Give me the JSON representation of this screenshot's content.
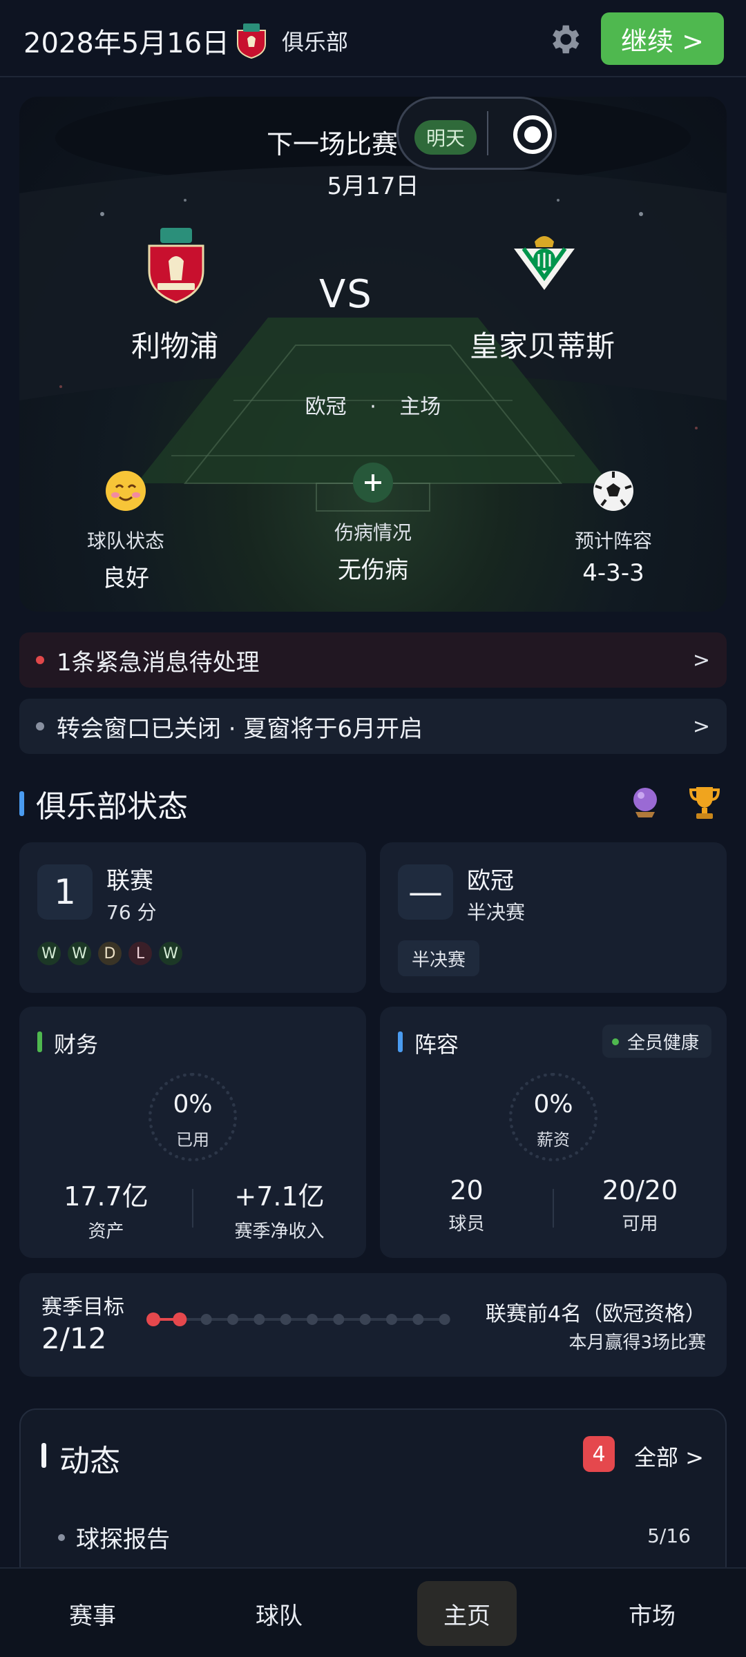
{
  "topbar": {
    "date": "2028年5月16日",
    "club_name": "俱乐部",
    "continue_label": "继续 >",
    "settings_icon": "gear-icon",
    "accent_color": "#4fb84f"
  },
  "next_match": {
    "label": "下一场比赛",
    "badge": "明天",
    "date": "5月17日",
    "home_team": "利物浦",
    "away_team": "皇家贝蒂斯",
    "vs": "VS",
    "competition": "欧冠",
    "separator": "·",
    "venue": "主场",
    "stats": [
      {
        "icon": "smile-face-icon",
        "label": "球队状态",
        "value": "良好"
      },
      {
        "icon": "plus-circle-icon",
        "label": "伤病情况",
        "value": "无伤病"
      },
      {
        "icon": "soccer-ball-icon",
        "label": "预计阵容",
        "value": "4-3-3"
      }
    ]
  },
  "notices": [
    {
      "text": "1条紧急消息待处理",
      "arrow": ">",
      "color": "#e0484a"
    },
    {
      "text": "转会窗口已关闭 · 夏窗将于6月开启",
      "arrow": ">",
      "color": "#8890a0"
    }
  ],
  "club_status": {
    "title": "俱乐部状态",
    "league": {
      "rank": "1",
      "title": "联赛",
      "points": "76 分",
      "form": [
        "W",
        "W",
        "D",
        "L",
        "W"
      ]
    },
    "ucl": {
      "rank": "—",
      "title": "欧冠",
      "stage": "半决赛",
      "tag": "半决赛"
    },
    "finance": {
      "title": "财务",
      "percent": "0%",
      "percent_label": "已用",
      "assets_value": "17.7亿",
      "assets_label": "资产",
      "income_value": "+7.1亿",
      "income_label": "赛季净收入"
    },
    "squad": {
      "title": "阵容",
      "health_badge": "全员健康",
      "percent": "0%",
      "percent_label": "薪资",
      "players_value": "20",
      "players_label": "球员",
      "available_value": "20/20",
      "available_label": "可用"
    },
    "season_goal": {
      "title": "赛季目标",
      "value": "2/12",
      "completed": 2,
      "total": 12,
      "description": "联赛前4名（欧冠资格）",
      "sub": "本月赢得3场比赛"
    }
  },
  "activity": {
    "title": "动态",
    "count": "4",
    "all_label": "全部 >",
    "items": [
      {
        "name": "球探报告",
        "date": "5/16"
      }
    ]
  },
  "bottom_nav": {
    "tabs": [
      {
        "label": "赛事",
        "active": false
      },
      {
        "label": "球队",
        "active": false
      },
      {
        "label": "主页",
        "active": true
      },
      {
        "label": "市场",
        "active": false
      }
    ]
  }
}
